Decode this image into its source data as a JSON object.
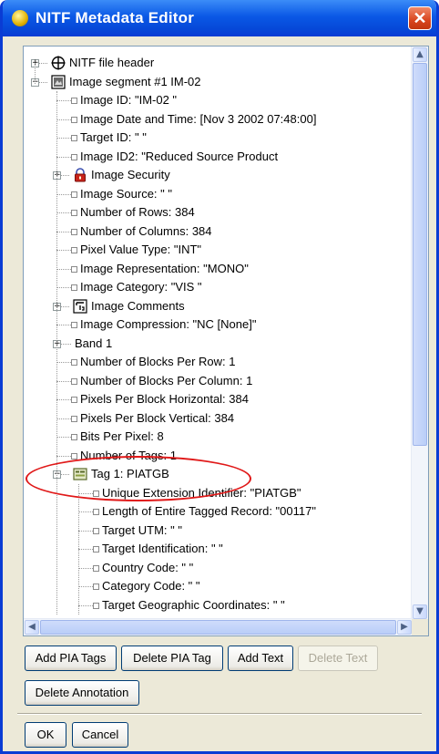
{
  "window": {
    "title": "NITF Metadata Editor",
    "close_glyph": "✕"
  },
  "tree": {
    "nodes": [
      {
        "label": "NITF file header",
        "level": 0,
        "expander": "+",
        "icon": "crosshair-icon"
      },
      {
        "label": "Image segment #1  IM-02",
        "level": 0,
        "expander": "−",
        "icon": "image-segment-icon"
      },
      {
        "label": "Image ID: \"IM-02      \"",
        "level": 1
      },
      {
        "label": "Image Date and Time: [Nov 3 2002 07:48:00]",
        "level": 1
      },
      {
        "label": "Target ID: \"                    \"",
        "level": 1
      },
      {
        "label": "Image ID2: \"Reduced Source Product",
        "level": 1
      },
      {
        "label": "Image Security",
        "level": 1,
        "expander": "+",
        "icon": "lock-icon"
      },
      {
        "label": "Image Source: \"                                          \"",
        "level": 1
      },
      {
        "label": "Number of Rows: 384",
        "level": 1
      },
      {
        "label": "Number of Columns: 384",
        "level": 1
      },
      {
        "label": "Pixel Value Type: \"INT\"",
        "level": 1
      },
      {
        "label": "Image Representation: \"MONO\"",
        "level": 1
      },
      {
        "label": "Image Category: \"VIS     \"",
        "level": 1
      },
      {
        "label": "Image Comments",
        "level": 1,
        "expander": "+",
        "icon": "comments-icon"
      },
      {
        "label": "Image Compression: \"NC [None]\"",
        "level": 1
      },
      {
        "label": "Band 1",
        "level": 1,
        "expander": "+"
      },
      {
        "label": "Number of Blocks Per Row: 1",
        "level": 1
      },
      {
        "label": "Number of Blocks Per Column: 1",
        "level": 1
      },
      {
        "label": "Pixels Per Block Horizontal: 384",
        "level": 1
      },
      {
        "label": "Pixels Per Block Vertical: 384",
        "level": 1
      },
      {
        "label": "Bits Per Pixel: 8",
        "level": 1
      },
      {
        "label": "Number of Tags: 1",
        "level": 1
      },
      {
        "label": "Tag 1: PIATGB",
        "level": 1,
        "expander": "−",
        "icon": "tag-icon"
      },
      {
        "label": "Unique Extension Identifier: \"PIATGB\"",
        "level": 2
      },
      {
        "label": "Length of Entire Tagged Record: \"00117\"",
        "level": 2
      },
      {
        "label": "Target UTM: \"               \"",
        "level": 2
      },
      {
        "label": "Target Identification: \"                    \"",
        "level": 2
      },
      {
        "label": "Country Code: \"  \"",
        "level": 2
      },
      {
        "label": "Category Code: \"     \"",
        "level": 2
      },
      {
        "label": "Target Geographic Coordinates: \"                  \"",
        "level": 2
      }
    ],
    "highlighted": "Tag 1: PIATGB"
  },
  "scrollbar": {
    "up": "▲",
    "down": "▼",
    "left": "◀",
    "right": "▶"
  },
  "buttons": {
    "add_pia_tags": "Add PIA Tags",
    "delete_pia_tag": "Delete PIA Tag",
    "add_text": "Add Text",
    "delete_text": "Delete Text",
    "delete_annotation": "Delete Annotation",
    "ok": "OK",
    "cancel": "Cancel"
  },
  "colors": {
    "titlebar": "#0a58e6",
    "highlight_ring": "#e01818",
    "dialog_bg": "#ece9d8"
  }
}
